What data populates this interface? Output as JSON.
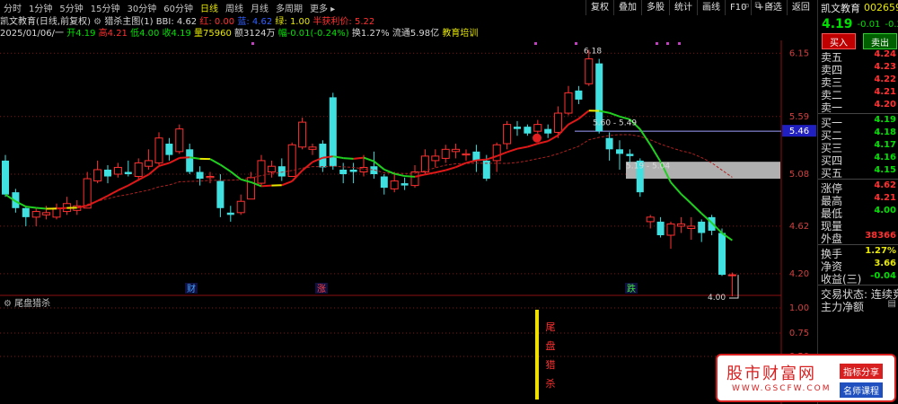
{
  "periods": [
    "分时",
    "1分钟",
    "5分钟",
    "15分钟",
    "30分钟",
    "60分钟",
    "日线",
    "周线",
    "月线",
    "多周期",
    "更多"
  ],
  "active_period": "日线",
  "toolbar": [
    "复权",
    "叠加",
    "多股",
    "统计",
    "画线",
    "F10",
    "+自选",
    "返回"
  ],
  "info1": {
    "stock": "凯文教育(日线,前复权)",
    "indicator": "猎杀主图(1)",
    "bbi_label": "BBI: 4.62",
    "hong_label": "红: 0.00",
    "lan_label": "蓝: 4.62",
    "lv_label": "绿: 1.00",
    "cost_label": "半获利价: 5.22"
  },
  "info2": {
    "date": "2025/01/06/一",
    "open": "开4.19",
    "high": "高4.21",
    "low": "低4.00",
    "close": "收4.19",
    "vol": "量75960",
    "amount": "额3124万",
    "change": "幅-0.01(-0.24%)",
    "turnover": "换1.27%",
    "float": "流通5.98亿",
    "tag": "教育培训"
  },
  "price_axis": [
    "6.15",
    "5.59",
    "5.08",
    "4.62",
    "4.20"
  ],
  "ind_axis": [
    "1.00",
    "0.75",
    "0.50"
  ],
  "hline_label": "5.46",
  "annotations": {
    "high": "6.18",
    "low": "4.00",
    "range1": "5.60 - 5.49",
    "range2": "5.19 - 5.04"
  },
  "event_labels": [
    "财",
    "涨",
    "跌"
  ],
  "indicator_title": "尾盘猎杀",
  "signal_text": [
    "尾",
    "盘",
    "猎",
    "杀"
  ],
  "chart_data": {
    "type": "candlestick",
    "ylim": [
      4.0,
      6.2
    ],
    "candles": [
      [
        5.2,
        4.9,
        5.25,
        4.88
      ],
      [
        4.92,
        4.78,
        4.95,
        4.74
      ],
      [
        4.78,
        4.7,
        4.8,
        4.62
      ],
      [
        4.7,
        4.75,
        4.78,
        4.62
      ],
      [
        4.72,
        4.74,
        4.8,
        4.68
      ],
      [
        4.7,
        4.78,
        4.82,
        4.68
      ],
      [
        4.75,
        4.82,
        4.88,
        4.72
      ],
      [
        4.76,
        4.8,
        4.85,
        4.72
      ],
      [
        4.78,
        5.04,
        5.1,
        4.78
      ],
      [
        5.02,
        5.12,
        5.2,
        5.0
      ],
      [
        5.12,
        5.06,
        5.16,
        5.0
      ],
      [
        5.08,
        5.14,
        5.18,
        5.05
      ],
      [
        5.1,
        5.08,
        5.2,
        5.06
      ],
      [
        5.06,
        5.18,
        5.22,
        5.02
      ],
      [
        5.15,
        5.2,
        5.3,
        5.12
      ],
      [
        5.18,
        5.4,
        5.45,
        5.16
      ],
      [
        5.35,
        5.25,
        5.4,
        5.2
      ],
      [
        5.28,
        5.48,
        5.52,
        5.26
      ],
      [
        5.3,
        5.1,
        5.35,
        5.08
      ],
      [
        5.1,
        5.04,
        5.15,
        4.98
      ],
      [
        5.05,
        5.06,
        5.1,
        5.0
      ],
      [
        5.02,
        4.78,
        5.08,
        4.7
      ],
      [
        4.74,
        4.72,
        4.8,
        4.66
      ],
      [
        4.74,
        4.84,
        4.9,
        4.72
      ],
      [
        4.86,
        5.05,
        5.1,
        4.86
      ],
      [
        5.0,
        5.2,
        5.25,
        4.98
      ],
      [
        5.1,
        5.15,
        5.2,
        5.05
      ],
      [
        5.15,
        5.06,
        5.22,
        5.02
      ],
      [
        5.06,
        5.34,
        5.36,
        5.06
      ],
      [
        5.32,
        5.54,
        5.58,
        5.3
      ],
      [
        5.3,
        5.32,
        5.35,
        5.25
      ],
      [
        5.35,
        5.14,
        5.38,
        5.1
      ],
      [
        5.76,
        5.15,
        5.8,
        5.12
      ],
      [
        5.12,
        5.08,
        5.18,
        5.0
      ],
      [
        5.12,
        5.1,
        5.18,
        5.0
      ],
      [
        5.1,
        5.14,
        5.25,
        5.06
      ],
      [
        5.15,
        5.08,
        5.28,
        5.04
      ],
      [
        5.06,
        4.96,
        5.08,
        4.9
      ],
      [
        4.95,
        5.02,
        5.1,
        4.92
      ],
      [
        5.0,
        4.98,
        5.05,
        4.94
      ],
      [
        4.98,
        5.1,
        5.16,
        4.96
      ],
      [
        5.1,
        5.24,
        5.3,
        5.08
      ],
      [
        5.2,
        5.24,
        5.3,
        5.14
      ],
      [
        5.22,
        5.3,
        5.34,
        5.18
      ],
      [
        5.28,
        5.3,
        5.35,
        5.22
      ],
      [
        5.25,
        5.26,
        5.3,
        5.2
      ],
      [
        5.28,
        5.2,
        5.34,
        5.1
      ],
      [
        5.2,
        5.04,
        5.25,
        5.02
      ],
      [
        5.2,
        5.34,
        5.36,
        5.1
      ],
      [
        5.35,
        5.52,
        5.55,
        5.3
      ],
      [
        5.5,
        5.48,
        5.55,
        5.42
      ],
      [
        5.5,
        5.44,
        5.52,
        5.42
      ],
      [
        5.46,
        5.52,
        5.56,
        5.44
      ],
      [
        5.48,
        5.44,
        5.52,
        5.4
      ],
      [
        5.45,
        5.62,
        5.68,
        5.4
      ],
      [
        5.62,
        5.8,
        5.86,
        5.6
      ],
      [
        5.82,
        5.74,
        5.86,
        5.7
      ],
      [
        5.88,
        6.1,
        6.18,
        5.86
      ],
      [
        6.06,
        5.46,
        6.1,
        5.44
      ],
      [
        5.4,
        5.3,
        5.45,
        5.2
      ],
      [
        5.3,
        5.26,
        5.38,
        5.12
      ],
      [
        5.26,
        5.24,
        5.3,
        5.18
      ],
      [
        5.2,
        4.92,
        5.22,
        4.88
      ],
      [
        4.66,
        4.7,
        4.72,
        4.6
      ],
      [
        4.66,
        4.54,
        4.7,
        4.52
      ],
      [
        4.54,
        4.64,
        4.66,
        4.42
      ],
      [
        4.62,
        4.64,
        4.7,
        4.56
      ],
      [
        4.6,
        4.62,
        4.7,
        4.5
      ],
      [
        4.66,
        4.56,
        4.68,
        4.48
      ],
      [
        4.7,
        4.58,
        4.72,
        4.54
      ],
      [
        4.56,
        4.19,
        4.6,
        4.18
      ],
      [
        4.19,
        4.19,
        4.21,
        4.0
      ]
    ]
  },
  "right_panel": {
    "name": "凯文教育",
    "code": "002659",
    "price": "4.19",
    "change": "-0.01",
    "pct": "-0.24%",
    "buy_btn": "买入",
    "sell_btn": "卖出",
    "sell_rows": [
      {
        "label": "卖五",
        "value": "4.24"
      },
      {
        "label": "卖四",
        "value": "4.23"
      },
      {
        "label": "卖三",
        "value": "4.22"
      },
      {
        "label": "卖二",
        "value": "4.21"
      },
      {
        "label": "卖一",
        "value": "4.20"
      }
    ],
    "buy_rows": [
      {
        "label": "买一",
        "value": "4.19"
      },
      {
        "label": "买二",
        "value": "4.18"
      },
      {
        "label": "买三",
        "value": "4.17"
      },
      {
        "label": "买四",
        "value": "4.16"
      },
      {
        "label": "买五",
        "value": "4.15"
      }
    ],
    "stat_rows": [
      {
        "label": "涨停",
        "value": "4.62"
      },
      {
        "label": "最高",
        "value": "4.21"
      },
      {
        "label": "最低",
        "value": "4.00"
      },
      {
        "label": "现量",
        "value": ""
      },
      {
        "label": "外盘",
        "value": "38366"
      }
    ],
    "extra_rows": [
      {
        "label": "换手",
        "value": "1.27%"
      },
      {
        "label": "净资",
        "value": "3.66"
      },
      {
        "label": "收益(三)",
        "value": "-0.04"
      }
    ],
    "trade_state": "交易状态: 连续竞价",
    "main_net": "主力净额"
  },
  "watermark": {
    "logo": "股市财富网",
    "url": "WWW.GSCFW.COM",
    "tag1": "指标分享",
    "tag2": "名师课程"
  },
  "colors": {
    "up": "#ff3030",
    "down": "#40e0e0",
    "bg": "#000000",
    "grid": "#8b1010"
  }
}
